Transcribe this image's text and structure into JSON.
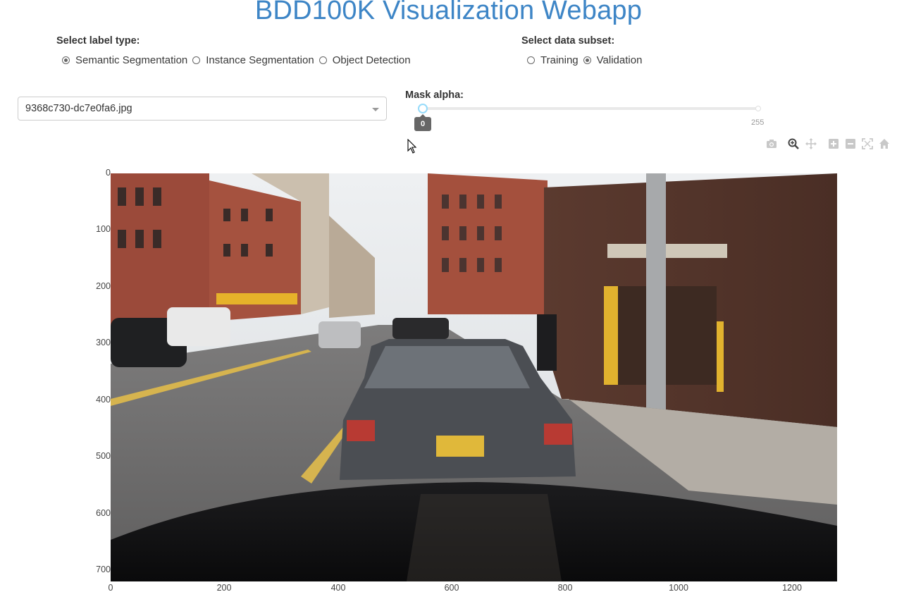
{
  "header": {
    "title": "BDD100K Visualization Webapp"
  },
  "label_type": {
    "label": "Select label type:",
    "options": [
      {
        "label": "Semantic Segmentation",
        "selected": true
      },
      {
        "label": "Instance Segmentation",
        "selected": false
      },
      {
        "label": "Object Detection",
        "selected": false
      }
    ]
  },
  "data_subset": {
    "label": "Select data subset:",
    "options": [
      {
        "label": "Training",
        "selected": false
      },
      {
        "label": "Validation",
        "selected": true
      }
    ]
  },
  "image_select": {
    "value": "9368c730-dc7e0fa6.jpg"
  },
  "mask_alpha": {
    "label": "Mask alpha:",
    "value": "0",
    "max_label": "255",
    "value_fraction": 0
  },
  "modebar": {
    "icons": [
      "camera-icon",
      "zoom-icon",
      "pan-icon",
      "zoom-in-icon",
      "zoom-out-icon",
      "autoscale-icon",
      "home-icon"
    ]
  },
  "plot": {
    "y_ticks": [
      "0",
      "100",
      "200",
      "300",
      "400",
      "500",
      "600",
      "700"
    ],
    "x_ticks": [
      "0",
      "200",
      "400",
      "600",
      "800",
      "1000",
      "1200"
    ],
    "image_description_icon": "street-photo"
  },
  "colors": {
    "title": "#3d85c6",
    "slider_handle_border": "#96dbfa",
    "tooltip_bg": "#666666"
  }
}
